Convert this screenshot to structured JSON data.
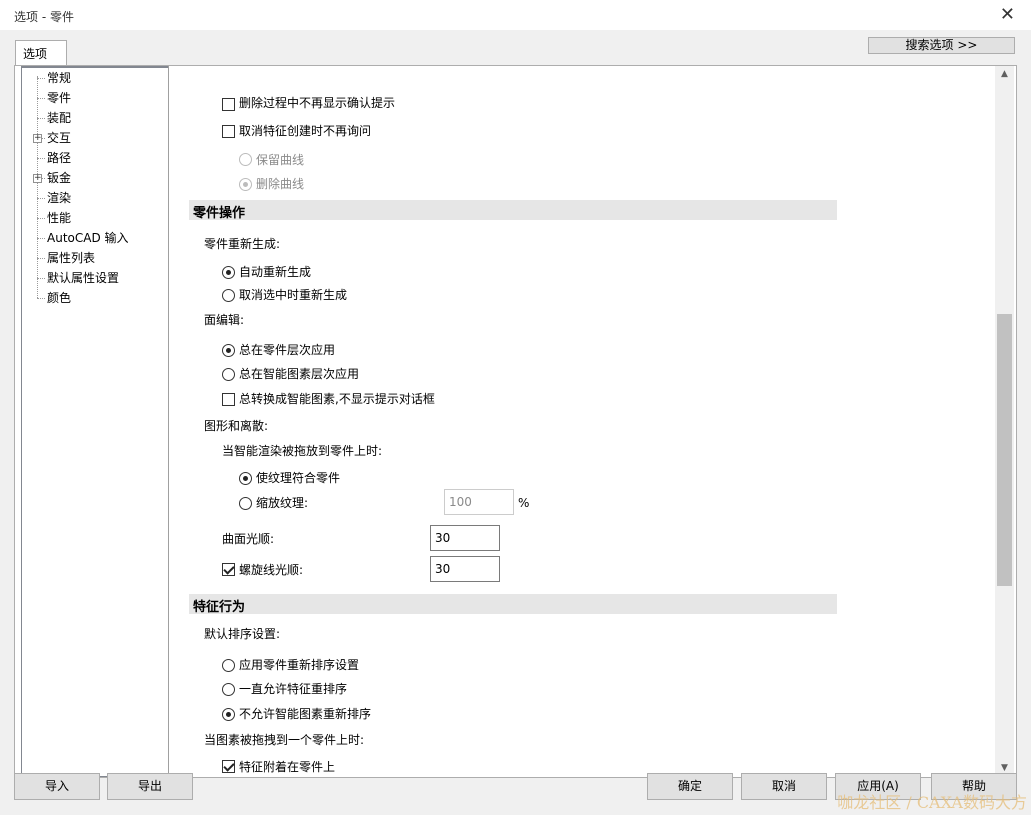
{
  "window": {
    "title": "选项 - 零件",
    "close_symbol": "✕"
  },
  "tabs": [
    {
      "label": "选项"
    }
  ],
  "search_button": {
    "label": "搜索选项 >>"
  },
  "tree": {
    "items": [
      {
        "label": "常规",
        "expandable": false
      },
      {
        "label": "零件",
        "expandable": false,
        "selected": true
      },
      {
        "label": "装配",
        "expandable": false
      },
      {
        "label": "交互",
        "expandable": true
      },
      {
        "label": "路径",
        "expandable": false
      },
      {
        "label": "钣金",
        "expandable": true
      },
      {
        "label": "渲染",
        "expandable": false
      },
      {
        "label": "性能",
        "expandable": false
      },
      {
        "label": "AutoCAD 输入",
        "expandable": false
      },
      {
        "label": "属性列表",
        "expandable": false
      },
      {
        "label": "默认属性设置",
        "expandable": false
      },
      {
        "label": "颜色",
        "expandable": false
      }
    ],
    "expand_symbol": "+"
  },
  "content": {
    "delete_no_confirm": {
      "label": "删除过程中不再显示确认提示",
      "checked": false
    },
    "cancel_feature_no_ask": {
      "label": "取消特征创建时不再询问",
      "checked": false
    },
    "keep_curve": {
      "label": "保留曲线",
      "checked": false,
      "disabled": true
    },
    "delete_curve": {
      "label": "删除曲线",
      "checked": true,
      "disabled": true
    },
    "section_part_ops": "零件操作",
    "regen_label": "零件重新生成:",
    "auto_regen": {
      "label": "自动重新生成",
      "checked": true
    },
    "regen_on_deselect": {
      "label": "取消选中时重新生成",
      "checked": false
    },
    "face_edit_label": "面编辑:",
    "apply_part_level": {
      "label": "总在零件层次应用",
      "checked": true
    },
    "apply_ic_level": {
      "label": "总在智能图素层次应用",
      "checked": false
    },
    "convert_ic_no_prompt": {
      "label": "总转换成智能图素,不显示提示对话框",
      "checked": false
    },
    "shape_discrete_label": "图形和离散:",
    "render_drop_label": "当智能渲染被拖放到零件上时:",
    "texture_fit": {
      "label": "使纹理符合零件",
      "checked": true
    },
    "scale_texture": {
      "label": "缩放纹理:",
      "checked": false,
      "value": "100",
      "unit": "%"
    },
    "surface_smooth": {
      "label": "曲面光顺:",
      "value": "30"
    },
    "thread_smooth": {
      "label": "螺旋线光顺:",
      "checked": true,
      "value": "30"
    },
    "section_feature": "特征行为",
    "default_order_label": "默认排序设置:",
    "apply_part_reorder": {
      "label": "应用零件重新排序设置",
      "checked": false
    },
    "always_allow_reorder": {
      "label": "一直允许特征重排序",
      "checked": false
    },
    "disallow_ic_reorder": {
      "label": "不允许智能图素重新排序",
      "checked": true
    },
    "drop_on_part_label": "当图素被拖拽到一个零件上时:",
    "attach_feature": {
      "label": "特征附着在零件上",
      "checked": true
    }
  },
  "scroll": {
    "up_symbol": "▲",
    "down_symbol": "▼"
  },
  "footer": {
    "import": "导入",
    "export": "导出",
    "ok": "确定",
    "cancel": "取消",
    "apply": "应用(A)",
    "help": "帮助"
  },
  "watermark": "咖龙社区 / CAXA数码大方"
}
